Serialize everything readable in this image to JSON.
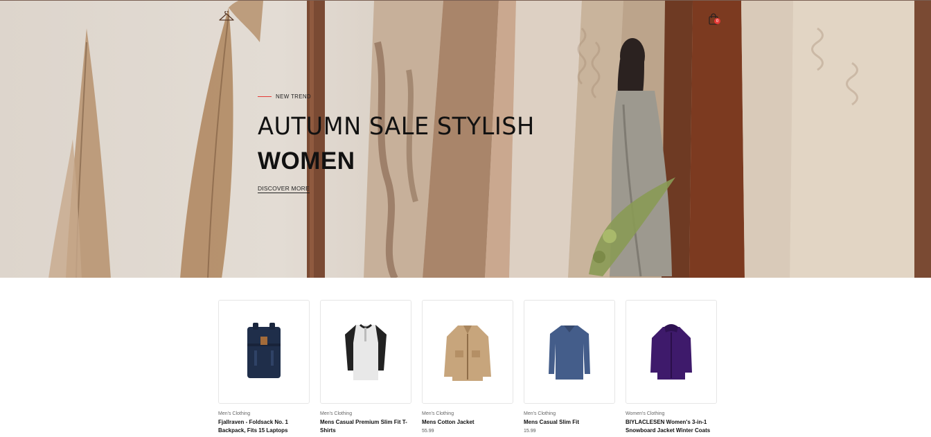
{
  "header": {
    "logo_icon": "hanger-icon",
    "cart_icon": "shopping-bag-icon",
    "cart_count": "0"
  },
  "hero": {
    "tagline": "NEW TREND",
    "headline": "AUTUMN SALE STYLISH",
    "headline_bold": "WOMEN",
    "cta_label": "DISCOVER MORE",
    "accent_color": "#e53935"
  },
  "products": [
    {
      "category": "Men's Clothing",
      "title": "Fjallraven - Foldsack No. 1 Backpack, Fits 15 Laptops",
      "price": "",
      "image_icon": "backpack-icon"
    },
    {
      "category": "Men's Clothing",
      "title": "Mens Casual Premium Slim Fit T-Shirts",
      "price": "",
      "image_icon": "tshirt-icon"
    },
    {
      "category": "Men's Clothing",
      "title": "Mens Cotton Jacket",
      "price": "55.99",
      "image_icon": "jacket-icon"
    },
    {
      "category": "Men's Clothing",
      "title": "Mens Casual Slim Fit",
      "price": "15.99",
      "image_icon": "longsleeve-icon"
    },
    {
      "category": "Women's Clothing",
      "title": "BIYLACLESEN Women's 3-in-1 Snowboard Jacket Winter Coats",
      "price": "",
      "image_icon": "coat-icon"
    }
  ]
}
